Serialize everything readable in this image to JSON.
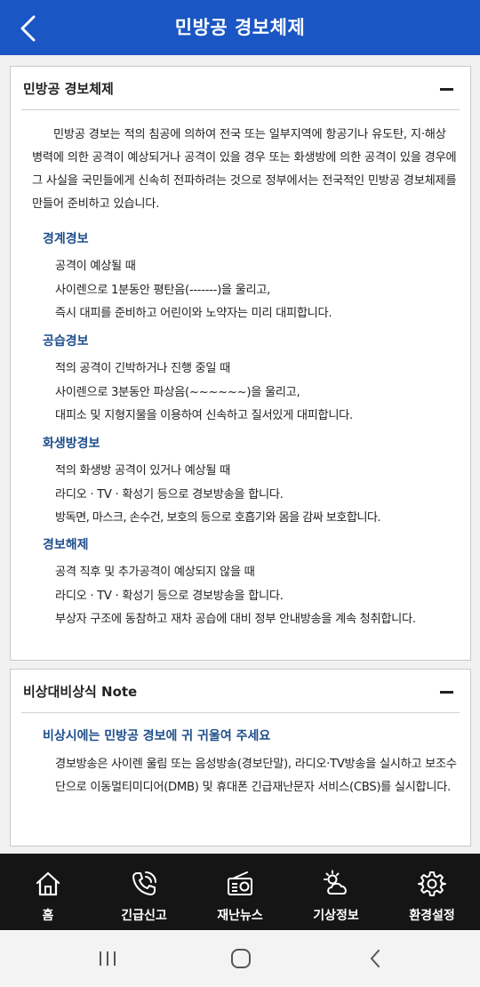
{
  "header": {
    "title": "민방공 경보체제",
    "back_icon": "chevron-left-icon"
  },
  "colors": {
    "header_bg": "#1a56c4",
    "section_title": "#1e4e8c",
    "tabbar_bg": "#151515"
  },
  "card1": {
    "title": "민방공 경보체제",
    "collapse_icon": "minus-icon",
    "intro": "민방공 경보는 적의 침공에 의하여 전국 또는 일부지역에 항공기나 유도탄, 지·해상 병력에 의한 공격이 예상되거나 공격이 있을 경우 또는 화생방에 의한 공격이 있을 경우에 그 사실을 국민들에게 신속히 전파하려는 것으로 정부에서는 전국적인 민방공 경보체제를 만들어 준비하고 있습니다.",
    "sections": [
      {
        "title": "경계경보",
        "lines": [
          "공격이 예상될 때",
          "사이렌으로 1분동안 평탄음(-------)을 울리고,",
          "즉시 대피를 준비하고 어린이와 노약자는 미리 대피합니다."
        ]
      },
      {
        "title": "공습경보",
        "lines": [
          "적의 공격이 긴박하거나 진행 중일 때",
          "사이렌으로 3분동안 파상음(~~~~~~)을 울리고,",
          "대피소 및 지형지물을 이용하여 신속하고 질서있게 대피합니다."
        ]
      },
      {
        "title": "화생방경보",
        "lines": [
          "적의 화생방 공격이 있거나 예상될 때",
          "라디오 · TV · 확성기 등으로 경보방송을 합니다.",
          "방독면, 마스크, 손수건, 보호의 등으로 호흡기와 몸을 감싸 보호합니다."
        ]
      },
      {
        "title": "경보해제",
        "lines": [
          "공격 직후 및 추가공격이 예상되지 않을 때",
          "라디오 · TV · 확성기 등으로 경보방송을 합니다.",
          "부상자 구조에 동참하고 재차 공습에 대비 정부 안내방송을 계속 청취합니다."
        ]
      }
    ]
  },
  "card2": {
    "title": "비상대비상식 Note",
    "collapse_icon": "minus-icon",
    "subtitle": "비상시에는 민방공 경보에 귀 귀울여 주세요",
    "body": "경보방송은 사이렌 울림 또는 음성방송(경보단말), 라디오·TV방송을 실시하고 보조수단으로 이동멀티미디어(DMB) 및 휴대폰 긴급재난문자 서비스(CBS)를 실시합니다."
  },
  "tabs": [
    {
      "label": "홈",
      "icon": "home-icon"
    },
    {
      "label": "긴급신고",
      "icon": "phone-call-icon"
    },
    {
      "label": "재난뉴스",
      "icon": "radio-icon"
    },
    {
      "label": "기상정보",
      "icon": "weather-icon"
    },
    {
      "label": "환경설정",
      "icon": "gear-icon"
    }
  ],
  "system_nav": {
    "recent_icon": "recent-apps-icon",
    "home_icon": "home-button-icon",
    "back_icon": "back-icon"
  }
}
